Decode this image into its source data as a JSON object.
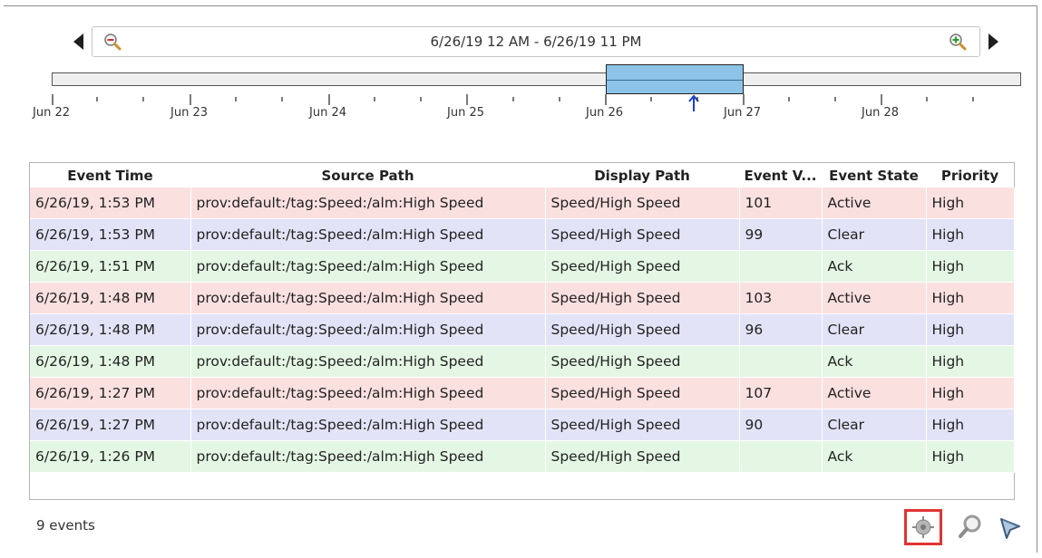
{
  "header": {
    "range_label": "6/26/19 12 AM - 6/26/19 11 PM"
  },
  "timeline": {
    "ticks": [
      "Jun 22",
      "Jun 23",
      "Jun 24",
      "Jun 25",
      "Jun 26",
      "Jun 27",
      "Jun 28"
    ]
  },
  "table": {
    "columns": [
      "Event Time",
      "Source Path",
      "Display Path",
      "Event V...",
      "Event State",
      "Priority"
    ],
    "rows": [
      {
        "time": "6/26/19, 1:53 PM",
        "source": "prov:default:/tag:Speed:/alm:High Speed",
        "display": "Speed/High Speed",
        "value": "101",
        "state": "Active",
        "priority": "High"
      },
      {
        "time": "6/26/19, 1:53 PM",
        "source": "prov:default:/tag:Speed:/alm:High Speed",
        "display": "Speed/High Speed",
        "value": "99",
        "state": "Clear",
        "priority": "High"
      },
      {
        "time": "6/26/19, 1:51 PM",
        "source": "prov:default:/tag:Speed:/alm:High Speed",
        "display": "Speed/High Speed",
        "value": "",
        "state": "Ack",
        "priority": "High"
      },
      {
        "time": "6/26/19, 1:48 PM",
        "source": "prov:default:/tag:Speed:/alm:High Speed",
        "display": "Speed/High Speed",
        "value": "103",
        "state": "Active",
        "priority": "High"
      },
      {
        "time": "6/26/19, 1:48 PM",
        "source": "prov:default:/tag:Speed:/alm:High Speed",
        "display": "Speed/High Speed",
        "value": "96",
        "state": "Clear",
        "priority": "High"
      },
      {
        "time": "6/26/19, 1:48 PM",
        "source": "prov:default:/tag:Speed:/alm:High Speed",
        "display": "Speed/High Speed",
        "value": "",
        "state": "Ack",
        "priority": "High"
      },
      {
        "time": "6/26/19, 1:27 PM",
        "source": "prov:default:/tag:Speed:/alm:High Speed",
        "display": "Speed/High Speed",
        "value": "107",
        "state": "Active",
        "priority": "High"
      },
      {
        "time": "6/26/19, 1:27 PM",
        "source": "prov:default:/tag:Speed:/alm:High Speed",
        "display": "Speed/High Speed",
        "value": "90",
        "state": "Clear",
        "priority": "High"
      },
      {
        "time": "6/26/19, 1:26 PM",
        "source": "prov:default:/tag:Speed:/alm:High Speed",
        "display": "Speed/High Speed",
        "value": "",
        "state": "Ack",
        "priority": "High"
      }
    ]
  },
  "footer": {
    "events_count": "9 events",
    "icons": [
      "crosshair-icon",
      "magnifier-icon",
      "filter-icon"
    ]
  },
  "colors": {
    "active_row": "#fbe0e0",
    "clear_row": "#e3e3f8",
    "ack_row": "#e4f7e4",
    "timeline_window": "#8cc3e6",
    "highlight_box": "#e03434"
  }
}
